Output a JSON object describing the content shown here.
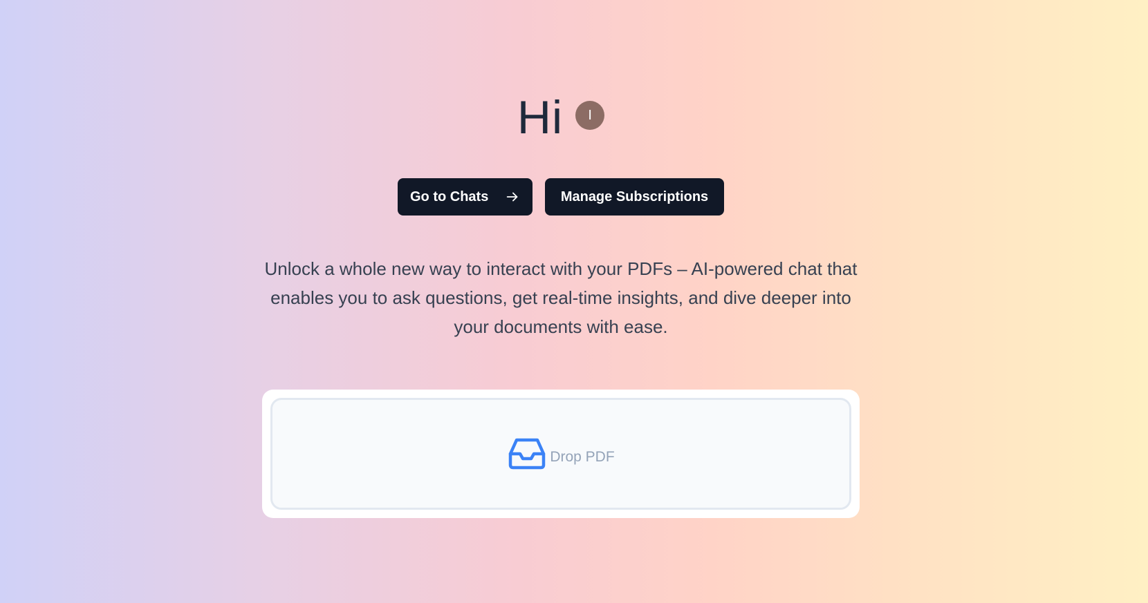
{
  "header": {
    "greeting": "Hi",
    "avatar_initial": "I",
    "avatar_color": "#8c6c64"
  },
  "actions": {
    "go_to_chats_label": "Go to Chats",
    "go_to_chats_icon": "arrow-right-icon",
    "manage_subscriptions_label": "Manage Subscriptions"
  },
  "description": "Unlock a whole new way to interact with your PDFs – AI-powered chat that enables you to ask questions, get real-time insights, and dive deeper into your documents with ease.",
  "upload": {
    "icon": "inbox-icon",
    "label": "Drop PDF",
    "icon_color": "#3b82f6"
  },
  "colors": {
    "button_bg": "#111827",
    "title_text": "#1e293b"
  }
}
